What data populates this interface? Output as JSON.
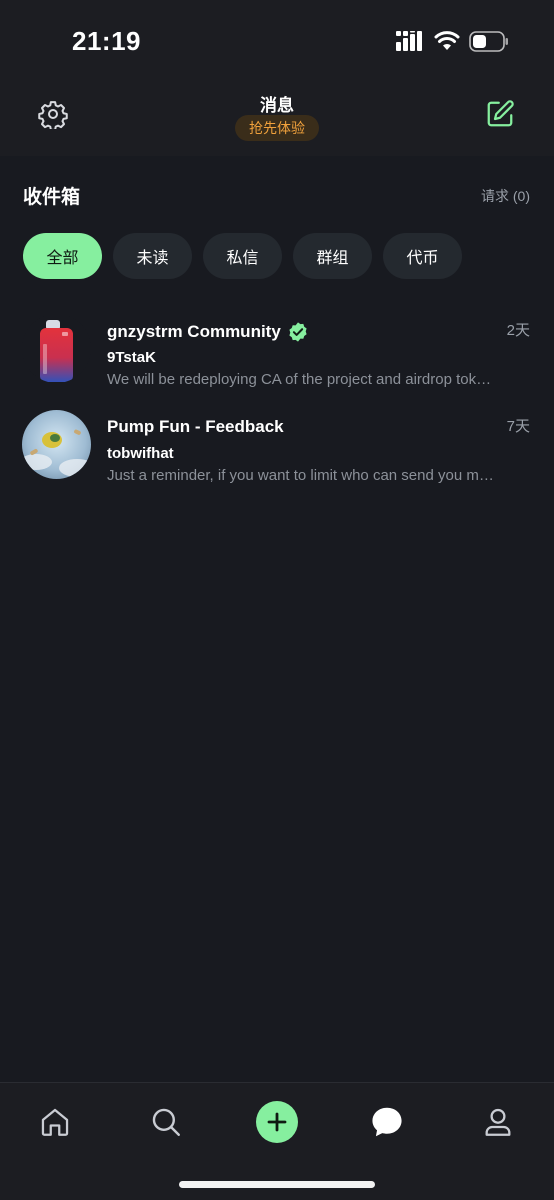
{
  "status_bar": {
    "time": "21:19",
    "icons": [
      "signal-icon",
      "wifi-icon",
      "battery-icon"
    ]
  },
  "header": {
    "title": "消息",
    "badge": "抢先体验",
    "left_icon": "gear-icon",
    "right_icon": "compose-icon"
  },
  "inbox": {
    "title": "收件箱",
    "requests": "请求 (0)"
  },
  "filters": [
    {
      "label": "全部",
      "active": true
    },
    {
      "label": "未读",
      "active": false
    },
    {
      "label": "私信",
      "active": false
    },
    {
      "label": "群组",
      "active": false
    },
    {
      "label": "代币",
      "active": false
    }
  ],
  "conversations": [
    {
      "name": "gnzystrm Community",
      "verified": true,
      "time": "2天",
      "sender": "9TstaK",
      "preview": "We will be redeploying CA of the project and airdrop tokens"
    },
    {
      "name": "Pump Fun - Feedback",
      "verified": false,
      "time": "7天",
      "sender": "tobwifhat",
      "preview": "Just a reminder, if you want to limit who can send you messages"
    }
  ],
  "bottom_nav": {
    "items": [
      "home-icon",
      "search-icon",
      "plus-icon",
      "chat-icon",
      "profile-icon"
    ],
    "active": "chat-icon"
  },
  "colors": {
    "background": "#181a20",
    "accent": "#86ef9f",
    "badge_text": "#f0a13c",
    "chip_bg": "#24292f"
  }
}
